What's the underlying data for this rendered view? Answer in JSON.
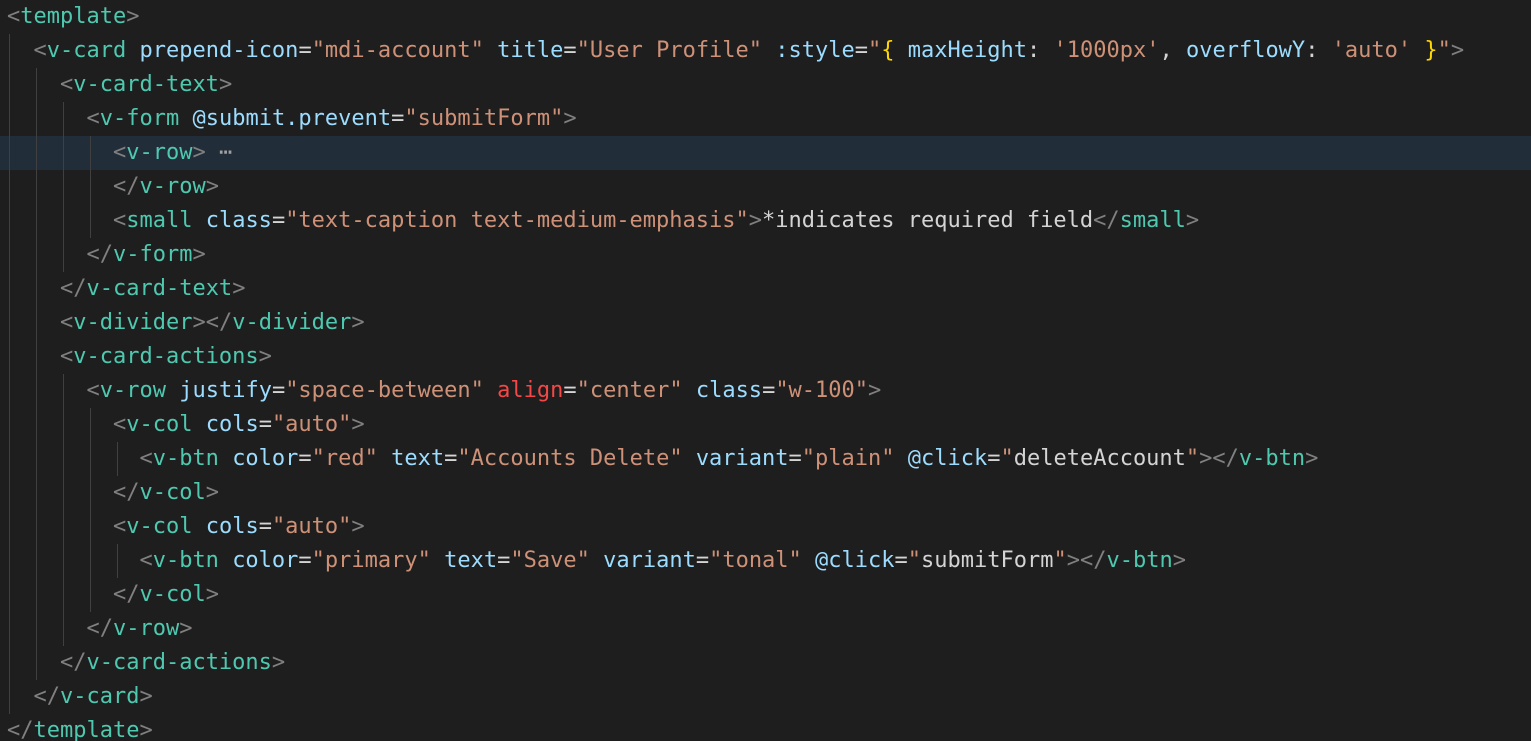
{
  "editor": {
    "current_line": 4,
    "lines": [
      {
        "indent": 0,
        "tokens": [
          [
            "c-punct",
            "<"
          ],
          [
            "c-tag",
            "template"
          ],
          [
            "c-punct",
            ">"
          ]
        ]
      },
      {
        "indent": 1,
        "tokens": [
          [
            "c-punct",
            "<"
          ],
          [
            "c-tag",
            "v-card"
          ],
          [
            "c-plain",
            " "
          ],
          [
            "c-attr",
            "prepend-icon"
          ],
          [
            "c-eq",
            "="
          ],
          [
            "c-str",
            "\"mdi-account\""
          ],
          [
            "c-plain",
            " "
          ],
          [
            "c-attr",
            "title"
          ],
          [
            "c-eq",
            "="
          ],
          [
            "c-str",
            "\"User Profile\""
          ],
          [
            "c-plain",
            " "
          ],
          [
            "c-attr",
            ":style"
          ],
          [
            "c-eq",
            "="
          ],
          [
            "c-str",
            "\""
          ],
          [
            "c-bracket",
            "{"
          ],
          [
            "c-plain",
            " "
          ],
          [
            "c-attr",
            "maxHeight"
          ],
          [
            "c-plain",
            ": "
          ],
          [
            "c-str",
            "'1000px'"
          ],
          [
            "c-plain",
            ", "
          ],
          [
            "c-attr",
            "overflowY"
          ],
          [
            "c-plain",
            ": "
          ],
          [
            "c-str",
            "'auto'"
          ],
          [
            "c-plain",
            " "
          ],
          [
            "c-bracket",
            "}"
          ],
          [
            "c-str",
            "\""
          ],
          [
            "c-punct",
            ">"
          ]
        ]
      },
      {
        "indent": 2,
        "tokens": [
          [
            "c-punct",
            "<"
          ],
          [
            "c-tag",
            "v-card-text"
          ],
          [
            "c-punct",
            ">"
          ]
        ]
      },
      {
        "indent": 3,
        "tokens": [
          [
            "c-punct",
            "<"
          ],
          [
            "c-tag",
            "v-form"
          ],
          [
            "c-plain",
            " "
          ],
          [
            "c-attr",
            "@submit.prevent"
          ],
          [
            "c-eq",
            "="
          ],
          [
            "c-str",
            "\"submitForm\""
          ],
          [
            "c-punct",
            ">"
          ]
        ]
      },
      {
        "indent": 4,
        "tokens": [
          [
            "c-punct",
            "<"
          ],
          [
            "c-tag",
            "v-row"
          ],
          [
            "c-punct",
            ">"
          ],
          [
            "c-fold",
            " ⋯"
          ]
        ]
      },
      {
        "indent": 4,
        "tokens": [
          [
            "c-punct",
            "</"
          ],
          [
            "c-tag",
            "v-row"
          ],
          [
            "c-punct",
            ">"
          ]
        ]
      },
      {
        "indent": 4,
        "tokens": [
          [
            "c-punct",
            "<"
          ],
          [
            "c-tag",
            "small"
          ],
          [
            "c-plain",
            " "
          ],
          [
            "c-attr",
            "class"
          ],
          [
            "c-eq",
            "="
          ],
          [
            "c-str",
            "\"text-caption text-medium-emphasis\""
          ],
          [
            "c-punct",
            ">"
          ],
          [
            "c-plain",
            "*indicates required field"
          ],
          [
            "c-punct",
            "</"
          ],
          [
            "c-tag",
            "small"
          ],
          [
            "c-punct",
            ">"
          ]
        ]
      },
      {
        "indent": 3,
        "tokens": [
          [
            "c-punct",
            "</"
          ],
          [
            "c-tag",
            "v-form"
          ],
          [
            "c-punct",
            ">"
          ]
        ]
      },
      {
        "indent": 2,
        "tokens": [
          [
            "c-punct",
            "</"
          ],
          [
            "c-tag",
            "v-card-text"
          ],
          [
            "c-punct",
            ">"
          ]
        ]
      },
      {
        "indent": 2,
        "tokens": [
          [
            "c-punct",
            "<"
          ],
          [
            "c-tag",
            "v-divider"
          ],
          [
            "c-punct",
            "></"
          ],
          [
            "c-tag",
            "v-divider"
          ],
          [
            "c-punct",
            ">"
          ]
        ]
      },
      {
        "indent": 2,
        "tokens": [
          [
            "c-punct",
            "<"
          ],
          [
            "c-tag",
            "v-card-actions"
          ],
          [
            "c-punct",
            ">"
          ]
        ]
      },
      {
        "indent": 3,
        "tokens": [
          [
            "c-punct",
            "<"
          ],
          [
            "c-tag",
            "v-row"
          ],
          [
            "c-plain",
            " "
          ],
          [
            "c-attr",
            "justify"
          ],
          [
            "c-eq",
            "="
          ],
          [
            "c-str",
            "\"space-between\""
          ],
          [
            "c-plain",
            " "
          ],
          [
            "c-attr-warn",
            "align"
          ],
          [
            "c-eq",
            "="
          ],
          [
            "c-str",
            "\"center\""
          ],
          [
            "c-plain",
            " "
          ],
          [
            "c-attr",
            "class"
          ],
          [
            "c-eq",
            "="
          ],
          [
            "c-str",
            "\"w-100\""
          ],
          [
            "c-punct",
            ">"
          ]
        ]
      },
      {
        "indent": 4,
        "tokens": [
          [
            "c-punct",
            "<"
          ],
          [
            "c-tag",
            "v-col"
          ],
          [
            "c-plain",
            " "
          ],
          [
            "c-attr",
            "cols"
          ],
          [
            "c-eq",
            "="
          ],
          [
            "c-str",
            "\"auto\""
          ],
          [
            "c-punct",
            ">"
          ]
        ]
      },
      {
        "indent": 5,
        "tokens": [
          [
            "c-punct",
            "<"
          ],
          [
            "c-tag",
            "v-btn"
          ],
          [
            "c-plain",
            " "
          ],
          [
            "c-attr",
            "color"
          ],
          [
            "c-eq",
            "="
          ],
          [
            "c-str",
            "\"red\""
          ],
          [
            "c-plain",
            " "
          ],
          [
            "c-attr",
            "text"
          ],
          [
            "c-eq",
            "="
          ],
          [
            "c-str",
            "\"Accounts Delete\""
          ],
          [
            "c-plain",
            " "
          ],
          [
            "c-attr",
            "variant"
          ],
          [
            "c-eq",
            "="
          ],
          [
            "c-str",
            "\"plain\""
          ],
          [
            "c-plain",
            " "
          ],
          [
            "c-attr",
            "@click"
          ],
          [
            "c-eq",
            "="
          ],
          [
            "c-str",
            "\""
          ],
          [
            "c-plain",
            "deleteAccount"
          ],
          [
            "c-str",
            "\""
          ],
          [
            "c-punct",
            "></"
          ],
          [
            "c-tag",
            "v-btn"
          ],
          [
            "c-punct",
            ">"
          ]
        ]
      },
      {
        "indent": 4,
        "tokens": [
          [
            "c-punct",
            "</"
          ],
          [
            "c-tag",
            "v-col"
          ],
          [
            "c-punct",
            ">"
          ]
        ]
      },
      {
        "indent": 4,
        "tokens": [
          [
            "c-punct",
            "<"
          ],
          [
            "c-tag",
            "v-col"
          ],
          [
            "c-plain",
            " "
          ],
          [
            "c-attr",
            "cols"
          ],
          [
            "c-eq",
            "="
          ],
          [
            "c-str",
            "\"auto\""
          ],
          [
            "c-punct",
            ">"
          ]
        ]
      },
      {
        "indent": 5,
        "tokens": [
          [
            "c-punct",
            "<"
          ],
          [
            "c-tag",
            "v-btn"
          ],
          [
            "c-plain",
            " "
          ],
          [
            "c-attr",
            "color"
          ],
          [
            "c-eq",
            "="
          ],
          [
            "c-str",
            "\"primary\""
          ],
          [
            "c-plain",
            " "
          ],
          [
            "c-attr",
            "text"
          ],
          [
            "c-eq",
            "="
          ],
          [
            "c-str",
            "\"Save\""
          ],
          [
            "c-plain",
            " "
          ],
          [
            "c-attr",
            "variant"
          ],
          [
            "c-eq",
            "="
          ],
          [
            "c-str",
            "\"tonal\""
          ],
          [
            "c-plain",
            " "
          ],
          [
            "c-attr",
            "@click"
          ],
          [
            "c-eq",
            "="
          ],
          [
            "c-str",
            "\""
          ],
          [
            "c-plain",
            "submitForm"
          ],
          [
            "c-str",
            "\""
          ],
          [
            "c-punct",
            "></"
          ],
          [
            "c-tag",
            "v-btn"
          ],
          [
            "c-punct",
            ">"
          ]
        ]
      },
      {
        "indent": 4,
        "tokens": [
          [
            "c-punct",
            "</"
          ],
          [
            "c-tag",
            "v-col"
          ],
          [
            "c-punct",
            ">"
          ]
        ]
      },
      {
        "indent": 3,
        "tokens": [
          [
            "c-punct",
            "</"
          ],
          [
            "c-tag",
            "v-row"
          ],
          [
            "c-punct",
            ">"
          ]
        ]
      },
      {
        "indent": 2,
        "tokens": [
          [
            "c-punct",
            "</"
          ],
          [
            "c-tag",
            "v-card-actions"
          ],
          [
            "c-punct",
            ">"
          ]
        ]
      },
      {
        "indent": 1,
        "tokens": [
          [
            "c-punct",
            "</"
          ],
          [
            "c-tag",
            "v-card"
          ],
          [
            "c-punct",
            ">"
          ]
        ]
      },
      {
        "indent": 0,
        "tokens": [
          [
            "c-punct",
            "</"
          ],
          [
            "c-tag",
            "template"
          ],
          [
            "c-punct",
            ">"
          ]
        ]
      }
    ]
  }
}
